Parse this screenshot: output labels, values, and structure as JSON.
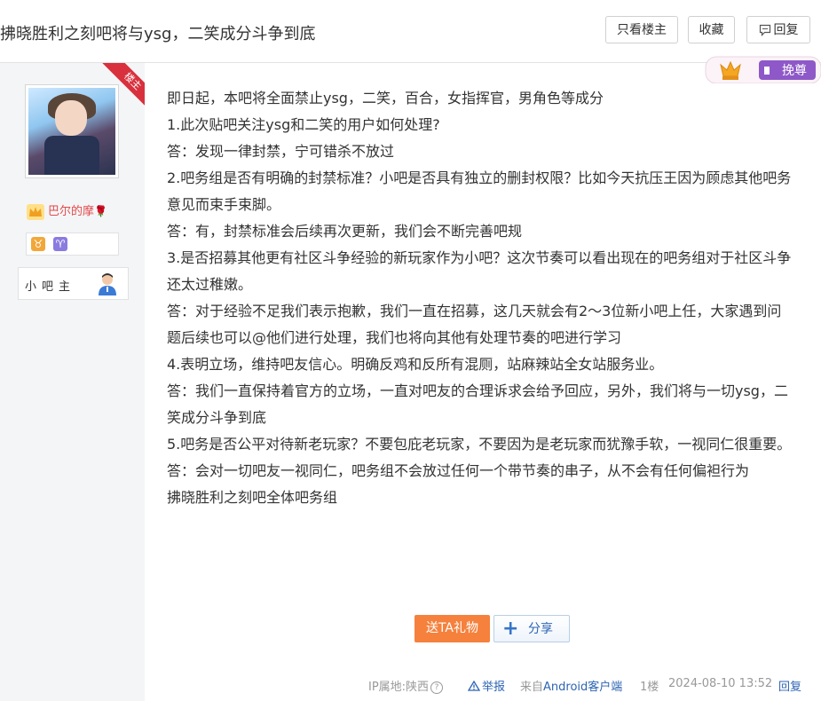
{
  "header": {
    "title": "拂晓胜利之刻吧将与ysg，二笑成分斗争到底",
    "only_lz_label": "只看楼主",
    "favorite_label": "收藏",
    "reply_label": "回复"
  },
  "user": {
    "ribbon_label": "楼主",
    "name": "巴尔的摩",
    "role": "小吧主",
    "badges": [
      "taurus",
      "aries"
    ]
  },
  "vip_label": "挽尊",
  "post": {
    "lines": [
      "即日起，本吧将全面禁止ysg，二笑，百合，女指挥官，男角色等成分",
      "1.此次贴吧关注ysg和二笑的用户如何处理?",
      "答：发现一律封禁，宁可错杀不放过",
      "2.吧务组是否有明确的封禁标准？小吧是否具有独立的删封权限？比如今天抗压王因为顾虑其他吧务意见而束手束脚。",
      "答：有，封禁标准会后续再次更新，我们会不断完善吧规",
      "3.是否招募其他更有社区斗争经验的新玩家作为小吧？这次节奏可以看出现在的吧务组对于社区斗争还太过稚嫩。",
      "答：对于经验不足我们表示抱歉，我们一直在招募，这几天就会有2～3位新小吧上任，大家遇到问题后续也可以@他们进行处理，我们也将向其他有处理节奏的吧进行学习",
      "4.表明立场，维持吧友信心。明确反鸡和反所有混厕，站麻辣站全女站服务业。",
      "答：我们一直保持着官方的立场，一直对吧友的合理诉求会给予回应，另外，我们将与一切ysg，二笑成分斗争到底",
      "5.吧务是否公平对待新老玩家？不要包庇老玩家，不要因为是老玩家而犹豫手软，一视同仁很重要。",
      "答：会对一切吧友一视同仁，吧务组不会放过任何一个带节奏的串子，从不会有任何偏袒行为",
      "拂晓胜利之刻吧全体吧务组"
    ]
  },
  "actions": {
    "gift_label": "送TA礼物",
    "share_label": "分享"
  },
  "footer": {
    "ip_location": "IP属地:陕西",
    "report_label": "举报",
    "from_prefix": "来自",
    "from_client": "Android客户端",
    "floor": "1楼",
    "time": "2024-08-10 13:52",
    "reply_label": "回复"
  }
}
